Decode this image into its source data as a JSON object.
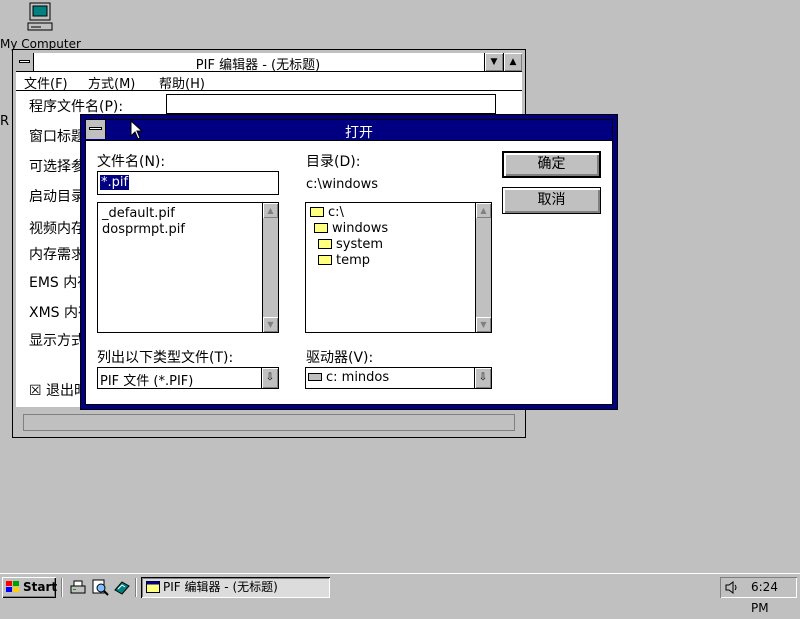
{
  "desktop": {
    "icon_label": "My Computer",
    "stray_char": "R"
  },
  "pif_window": {
    "title": "PIF 编辑器 - (无标题)",
    "menu": [
      "文件(F)",
      "方式(M)",
      "帮助(H)"
    ],
    "fields": [
      "程序文件名(P):",
      "窗口标题",
      "可选择参",
      "启动目录",
      "视频内存",
      "内存需求",
      "EMS 内存",
      "XMS 内存",
      "显示方式",
      "☒ 退出时"
    ],
    "min_arrow": "▼",
    "max_arrow": "▲"
  },
  "open_dialog": {
    "title": "打开",
    "file_name_label": "文件名(N):",
    "file_name_value": "*.pif",
    "files": [
      "_default.pif",
      "dosprmpt.pif"
    ],
    "directory_label": "目录(D):",
    "current_dir": "c:\\windows",
    "dirs": [
      {
        "name": "c:\\",
        "level": 0,
        "open": true
      },
      {
        "name": "windows",
        "level": 1,
        "open": true
      },
      {
        "name": "system",
        "level": 2,
        "open": false
      },
      {
        "name": "temp",
        "level": 2,
        "open": false
      }
    ],
    "file_type_label": "列出以下类型文件(T):",
    "file_type_value": "PIF 文件 (*.PIF)",
    "drive_label": "驱动器(V):",
    "drive_value": "c: mindos",
    "ok_label": "确定",
    "cancel_label": "取消",
    "up_arrow": "▲",
    "down_arrow": "▼",
    "dropdown_arrow": "⇩"
  },
  "taskbar": {
    "start_label": "Start",
    "task_label": "PIF 编辑器 - (无标题)",
    "clock": "6:24 PM"
  }
}
